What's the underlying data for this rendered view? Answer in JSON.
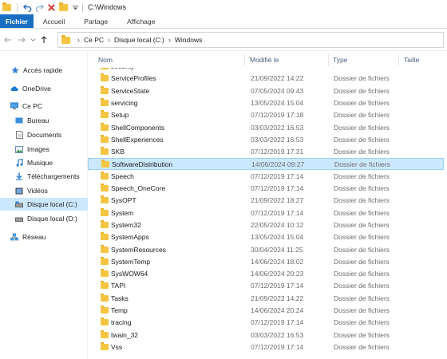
{
  "window": {
    "title": "C:\\Windows"
  },
  "ribbon": {
    "tabs": [
      "Fichier",
      "Accueil",
      "Partage",
      "Affichage"
    ]
  },
  "address": {
    "crumbs": [
      "Ce PC",
      "Disque local (C:)",
      "Windows"
    ]
  },
  "sidebar": {
    "items": [
      {
        "label": "Accès rapide",
        "icon": "star-icon"
      },
      {
        "label": "OneDrive",
        "icon": "cloud-icon"
      },
      {
        "label": "Ce PC",
        "icon": "computer-icon"
      },
      {
        "label": "Bureau",
        "icon": "desktop-icon"
      },
      {
        "label": "Documents",
        "icon": "document-icon"
      },
      {
        "label": "Images",
        "icon": "image-icon"
      },
      {
        "label": "Musique",
        "icon": "music-icon"
      },
      {
        "label": "Téléchargements",
        "icon": "download-icon"
      },
      {
        "label": "Vidéos",
        "icon": "video-icon"
      },
      {
        "label": "Disque local (C:)",
        "icon": "drive-icon",
        "selected": true
      },
      {
        "label": "Disque local (D:)",
        "icon": "drive-icon"
      },
      {
        "label": "Réseau",
        "icon": "network-icon"
      }
    ]
  },
  "columns": {
    "name": "Nom",
    "modified": "Modifié le",
    "type": "Type",
    "size": "Taille"
  },
  "files": [
    {
      "name": "security",
      "date": "",
      "type": ""
    },
    {
      "name": "ServiceProfiles",
      "date": "21/09/2022 14:22",
      "type": "Dossier de fichiers"
    },
    {
      "name": "ServiceState",
      "date": "07/05/2024 09:43",
      "type": "Dossier de fichiers"
    },
    {
      "name": "servicing",
      "date": "13/05/2024 15:04",
      "type": "Dossier de fichiers"
    },
    {
      "name": "Setup",
      "date": "07/12/2019 17:18",
      "type": "Dossier de fichiers"
    },
    {
      "name": "ShellComponents",
      "date": "03/03/2022 16:53",
      "type": "Dossier de fichiers"
    },
    {
      "name": "ShellExperiences",
      "date": "03/03/2022 16:53",
      "type": "Dossier de fichiers"
    },
    {
      "name": "SKB",
      "date": "07/12/2019 17:31",
      "type": "Dossier de fichiers"
    },
    {
      "name": "SoftwareDistribution",
      "date": "14/06/2024 09:27",
      "type": "Dossier de fichiers",
      "selected": true
    },
    {
      "name": "Speech",
      "date": "07/12/2019 17:14",
      "type": "Dossier de fichiers"
    },
    {
      "name": "Speech_OneCore",
      "date": "07/12/2019 17:14",
      "type": "Dossier de fichiers"
    },
    {
      "name": "SysOPT",
      "date": "21/09/2022 18:27",
      "type": "Dossier de fichiers"
    },
    {
      "name": "System",
      "date": "07/12/2019 17:14",
      "type": "Dossier de fichiers"
    },
    {
      "name": "System32",
      "date": "22/05/2024 10:12",
      "type": "Dossier de fichiers"
    },
    {
      "name": "SystemApps",
      "date": "13/05/2024 15:04",
      "type": "Dossier de fichiers"
    },
    {
      "name": "SystemResources",
      "date": "30/04/2024 11:25",
      "type": "Dossier de fichiers"
    },
    {
      "name": "SystemTemp",
      "date": "14/06/2024 18:02",
      "type": "Dossier de fichiers"
    },
    {
      "name": "SysWOW64",
      "date": "14/06/2024 20:23",
      "type": "Dossier de fichiers"
    },
    {
      "name": "TAPI",
      "date": "07/12/2019 17:14",
      "type": "Dossier de fichiers"
    },
    {
      "name": "Tasks",
      "date": "21/09/2022 14:22",
      "type": "Dossier de fichiers"
    },
    {
      "name": "Temp",
      "date": "14/06/2024 20:24",
      "type": "Dossier de fichiers"
    },
    {
      "name": "tracing",
      "date": "07/12/2019 17:14",
      "type": "Dossier de fichiers"
    },
    {
      "name": "twain_32",
      "date": "03/03/2022 16:53",
      "type": "Dossier de fichiers"
    },
    {
      "name": "Vss",
      "date": "07/12/2019 17:14",
      "type": "Dossier de fichiers"
    }
  ]
}
